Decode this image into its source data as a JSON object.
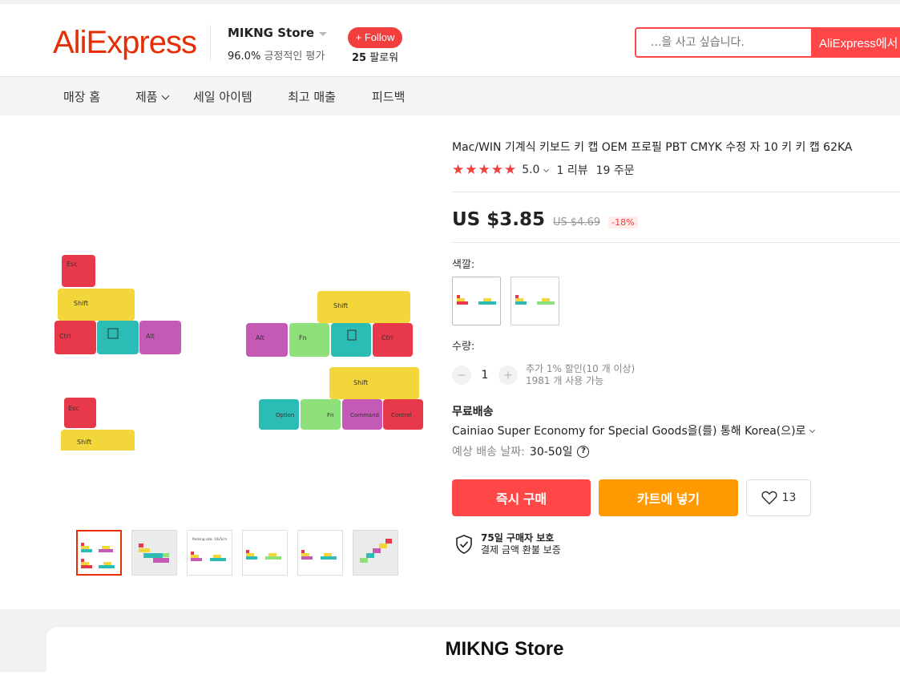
{
  "header": {
    "logo": "AliExpress",
    "store_name": "MIKNG Store",
    "rating_value": "96.0%",
    "rating_label": "긍정적인 평가",
    "follow_label": "+ Follow",
    "followers_count": "25",
    "followers_label": "팔로워",
    "search_placeholder": "...을 사고 싶습니다.",
    "search_button": "AliExpress에서"
  },
  "nav": {
    "items": [
      "매장 홈",
      "제품",
      "세일 아이템",
      "최고 매출",
      "피드백"
    ]
  },
  "product": {
    "title": "Mac/WIN 기계식 키보드 키 캡 OEM 프로필 PBT CMYK 수정 자 10 키 키 캡 62KA",
    "stars": "★★★★★",
    "rating": "5.0",
    "reviews": "1 리뷰",
    "orders": "19 주문",
    "price": "US $3.85",
    "old_price": "US $4.69",
    "discount": "-18%",
    "color_label": "색깔:",
    "quantity_label": "수량:",
    "quantity_value": "1",
    "qty_minus": "−",
    "qty_plus": "+",
    "bulk_discount": "추가 1% 할인(10 개 이상)",
    "available": "1981 개 사용 가능",
    "shipping_title": "무료배송",
    "shipping_method": "Cainiao Super Economy for Special Goods을(를) 통해 Korea(으)로",
    "delivery_label": "예상 배송 날짜:",
    "delivery_value": "30-50일",
    "buy_now": "즉시 구매",
    "add_to_cart": "카트에 넣기",
    "wishlist_count": "13",
    "protection_title": "75일 구매자 보호",
    "protection_sub": "결제 금액 환불 보증"
  },
  "keys": {
    "esc": "Esc",
    "shift": "Shift",
    "ctrl": "Ctrl",
    "alt": "Alt",
    "fn": "Fn",
    "control": "Control",
    "command": "Command",
    "option": "Option",
    "packing": "Packing size: 10x5cm"
  },
  "store_card": {
    "title": "MIKNG Store"
  },
  "colors": {
    "brand": "#e62e04",
    "buy": "#ff4747",
    "cart": "#ff9a00",
    "key_red": "#e8394a",
    "key_yellow": "#f2d63a",
    "key_teal": "#2bbcb5",
    "key_purple": "#c45ab5",
    "key_green": "#8ee07a"
  }
}
